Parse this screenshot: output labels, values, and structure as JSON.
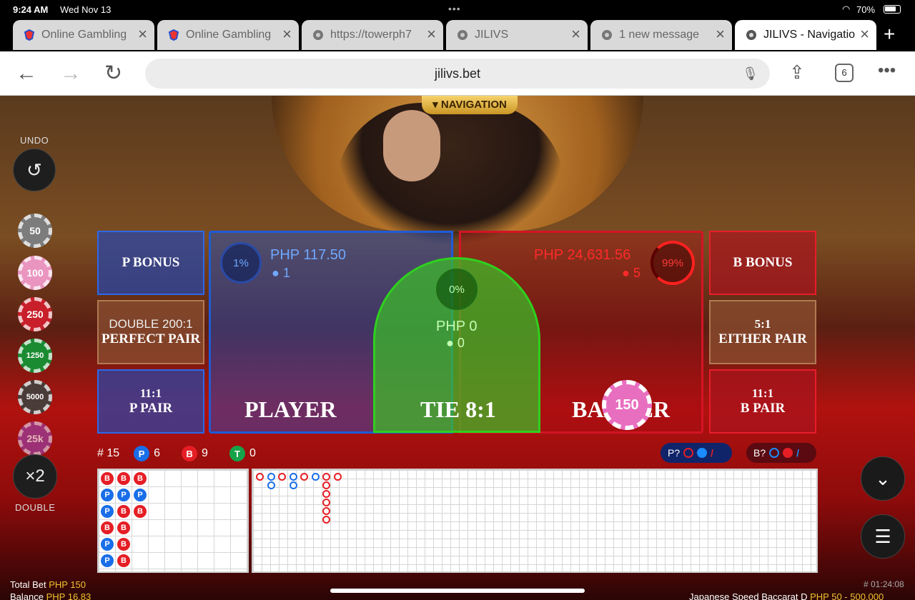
{
  "status": {
    "time": "9:24 AM",
    "date": "Wed Nov 13",
    "battery": "70%"
  },
  "tabs": [
    {
      "title": "Online Gambling"
    },
    {
      "title": "Online Gambling"
    },
    {
      "title": "https://towerph7"
    },
    {
      "title": "JILIVS"
    },
    {
      "title": "1 new message"
    },
    {
      "title": "JILIVS - Navigation"
    }
  ],
  "toolbar": {
    "url": "jilivs.bet",
    "tab_count": "6"
  },
  "game": {
    "navigation_label": "NAVIGATION",
    "undo_label": "UNDO",
    "double_label": "DOUBLE",
    "double_value": "×2",
    "chips": [
      "50",
      "100",
      "250",
      "1250",
      "5000",
      "25k"
    ],
    "bets": {
      "p_bonus": "P BONUS",
      "b_bonus": "B BONUS",
      "perfect_pair_odds": "DOUBLE 200:1",
      "perfect_pair": "PERFECT PAIR",
      "either_pair_odds": "5:1",
      "either_pair": "EITHER PAIR",
      "p_pair_odds": "11:1",
      "p_pair": "P PAIR",
      "b_pair_odds": "11:1",
      "b_pair": "B PAIR",
      "player": "PLAYER",
      "banker": "BANKER",
      "tie": "TIE 8:1"
    },
    "player": {
      "amount": "PHP 117.50",
      "people": "1",
      "percent": "1%"
    },
    "banker": {
      "amount": "PHP 24,631.56",
      "people": "5",
      "percent": "99%"
    },
    "tie": {
      "amount": "PHP 0",
      "people": "0",
      "percent": "0%"
    },
    "placed_chip": "150",
    "stats": {
      "round": "# 15",
      "p_count": "6",
      "b_count": "9",
      "t_count": "0",
      "p_label": "P",
      "b_label": "B",
      "t_label": "T"
    },
    "ask": {
      "p": "P?",
      "b": "B?"
    },
    "colors": {
      "player": "#1a6ee8",
      "banker": "#e51e25",
      "tie": "#17a34a"
    }
  },
  "footer": {
    "total_bet_label": "Total Bet",
    "total_bet": "PHP 150",
    "balance_label": "Balance",
    "balance": "PHP 16.83",
    "round_id": "# 01:24:08",
    "table_name": "Japanese Speed Baccarat D",
    "limits": "PHP 50 - 500,000"
  }
}
